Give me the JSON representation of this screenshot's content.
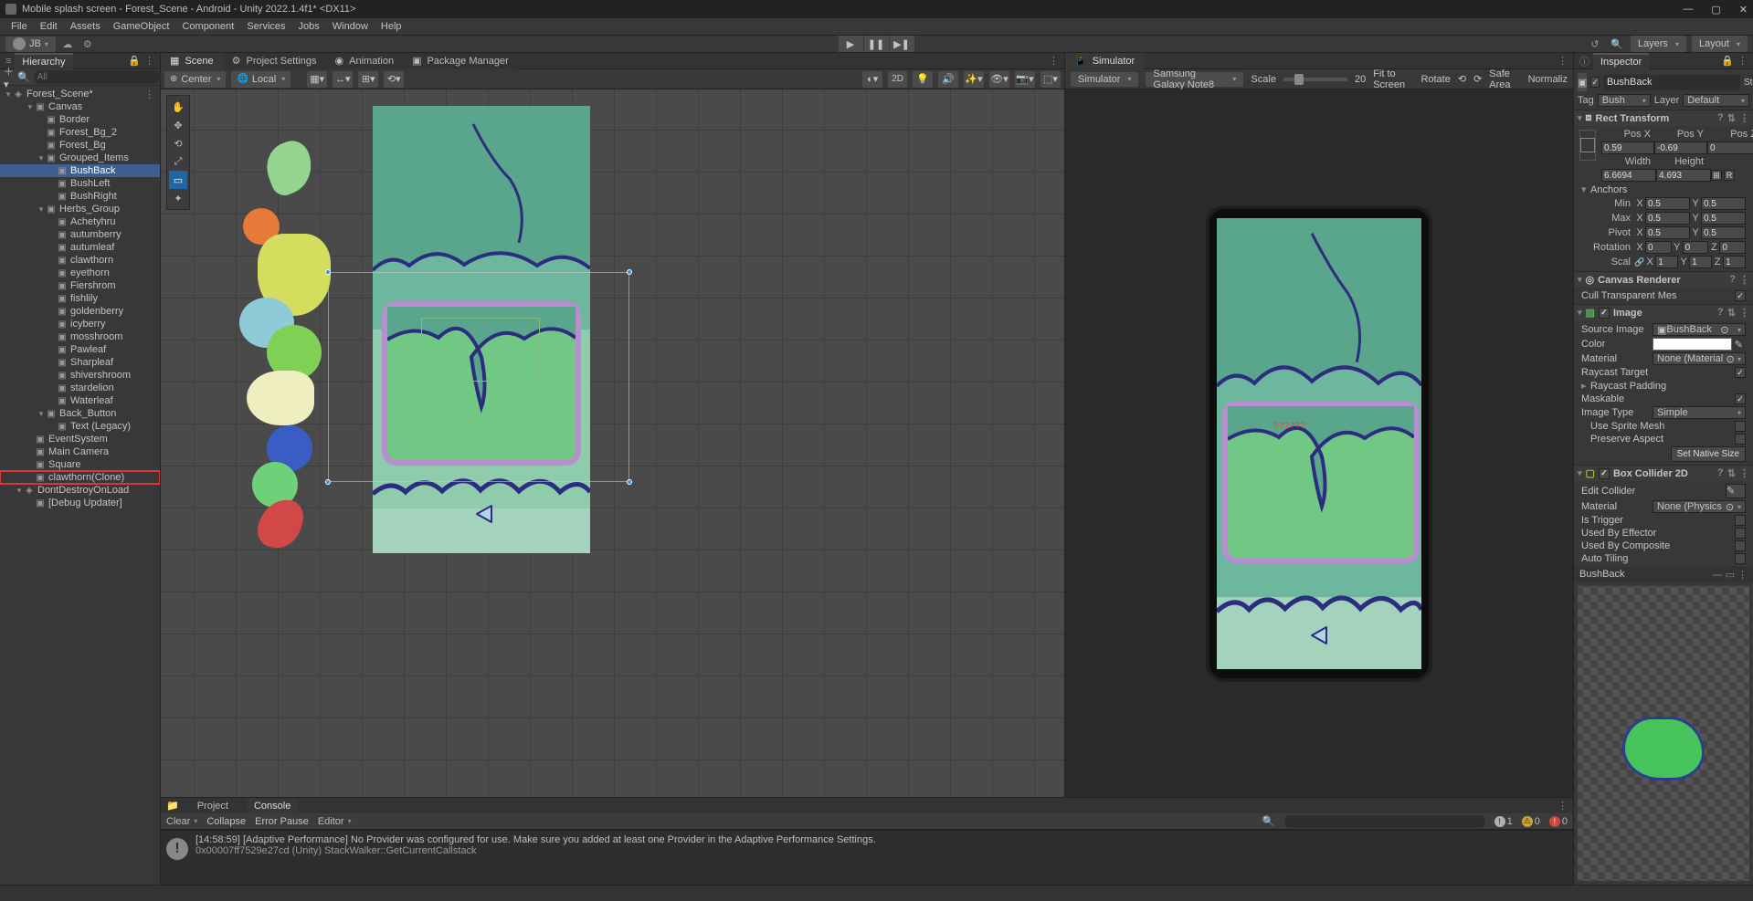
{
  "window": {
    "title": "Mobile splash screen - Forest_Scene - Android - Unity 2022.1.4f1* <DX11>"
  },
  "menu": [
    "File",
    "Edit",
    "Assets",
    "GameObject",
    "Component",
    "Services",
    "Jobs",
    "Window",
    "Help"
  ],
  "account": {
    "initials": "JB"
  },
  "layers_label": "Layers",
  "layout_label": "Layout",
  "hierarchy": {
    "title": "Hierarchy",
    "search_placeholder": "All",
    "scene": "Forest_Scene*",
    "tree": [
      {
        "label": "Canvas",
        "depth": 1,
        "folder": true
      },
      {
        "label": "Border",
        "depth": 2
      },
      {
        "label": "Forest_Bg_2",
        "depth": 2
      },
      {
        "label": "Forest_Bg",
        "depth": 2
      },
      {
        "label": "Grouped_Items",
        "depth": 2,
        "folder": true
      },
      {
        "label": "BushBack",
        "depth": 3,
        "selected": true
      },
      {
        "label": "BushLeft",
        "depth": 3
      },
      {
        "label": "BushRight",
        "depth": 3
      },
      {
        "label": "Herbs_Group",
        "depth": 2,
        "folder": true
      },
      {
        "label": "Achetyhru",
        "depth": 3
      },
      {
        "label": "autumberry",
        "depth": 3
      },
      {
        "label": "autumleaf",
        "depth": 3
      },
      {
        "label": "clawthorn",
        "depth": 3
      },
      {
        "label": "eyethorn",
        "depth": 3
      },
      {
        "label": "Fiershrom",
        "depth": 3
      },
      {
        "label": "fishlily",
        "depth": 3
      },
      {
        "label": "goldenberry",
        "depth": 3
      },
      {
        "label": "icyberry",
        "depth": 3
      },
      {
        "label": "mosshroom",
        "depth": 3
      },
      {
        "label": "Pawleaf",
        "depth": 3
      },
      {
        "label": "Sharpleaf",
        "depth": 3
      },
      {
        "label": "shivershroom",
        "depth": 3
      },
      {
        "label": "stardelion",
        "depth": 3
      },
      {
        "label": "Waterleaf",
        "depth": 3
      },
      {
        "label": "Back_Button",
        "depth": 2,
        "folder": true
      },
      {
        "label": "Text (Legacy)",
        "depth": 3
      },
      {
        "label": "EventSystem",
        "depth": 1
      },
      {
        "label": "Main Camera",
        "depth": 1
      },
      {
        "label": "Square",
        "depth": 1
      },
      {
        "label": "clawthorn(Clone)",
        "depth": 1,
        "boxed": true
      },
      {
        "label": "DontDestroyOnLoad",
        "depth": 0,
        "scene": true
      },
      {
        "label": "[Debug Updater]",
        "depth": 1
      }
    ]
  },
  "scene_tabs": [
    {
      "label": "Scene",
      "active": true,
      "icon": "scene"
    },
    {
      "label": "Project Settings",
      "icon": "gear"
    },
    {
      "label": "Animation",
      "icon": "anim"
    },
    {
      "label": "Package Manager",
      "icon": "pkg"
    }
  ],
  "scene_toolbar": {
    "pivot": "Center",
    "space": "Local",
    "two_d": "2D"
  },
  "simulator": {
    "title": "Simulator",
    "dropdown": "Simulator",
    "device": "Samsung Galaxy Note8",
    "scale_label": "Scale",
    "scale_value": "20",
    "fit": "Fit to Screen",
    "rotate": "Rotate",
    "safe": "Safe Area",
    "norm": "Normaliz"
  },
  "inspector": {
    "title": "Inspector",
    "go_name": "BushBack",
    "static": "Static",
    "tag_label": "Tag",
    "tag": "Bush",
    "layer_label": "Layer",
    "layer": "Default",
    "rect": {
      "title": "Rect Transform",
      "posx_l": "Pos X",
      "posy_l": "Pos Y",
      "posz_l": "Pos Z",
      "posx": "0.59",
      "posy": "-0.69",
      "posz": "0",
      "width_l": "Width",
      "height_l": "Height",
      "width": "6.6694",
      "height": "4.693",
      "anchors": "Anchors",
      "min_l": "Min",
      "min_x": "0.5",
      "min_y": "0.5",
      "max_l": "Max",
      "max_x": "0.5",
      "max_y": "0.5",
      "pivot_l": "Pivot",
      "piv_x": "0.5",
      "piv_y": "0.5",
      "rotation_l": "Rotation",
      "rot_x": "0",
      "rot_y": "0",
      "rot_z": "0",
      "scale_l": "Scal",
      "scl_x": "1",
      "scl_y": "1",
      "scl_z": "1"
    },
    "canvas_renderer": {
      "title": "Canvas Renderer",
      "cull": "Cull Transparent Mes"
    },
    "image": {
      "title": "Image",
      "src_l": "Source Image",
      "src": "BushBack",
      "color_l": "Color",
      "mat_l": "Material",
      "mat": "None (Material",
      "ray_l": "Raycast Target",
      "rayp_l": "Raycast Padding",
      "mask_l": "Maskable",
      "imgt_l": "Image Type",
      "imgt": "Simple",
      "spr_l": "Use Sprite Mesh",
      "presv_l": "Preserve Aspect",
      "setnat": "Set Native Size"
    },
    "box": {
      "title": "Box Collider 2D",
      "edit_l": "Edit Collider",
      "mat_l": "Material",
      "mat": "None (Physics",
      "trig_l": "Is Trigger",
      "eff_l": "Used By Effector",
      "comp_l": "Used By Composite",
      "auto_l": "Auto Tiling"
    },
    "preview_name": "BushBack"
  },
  "project_tabs": {
    "project": "Project",
    "console": "Console"
  },
  "console_toolbar": {
    "clear": "Clear",
    "collapse": "Collapse",
    "errp": "Error Pause",
    "editor": "Editor"
  },
  "console_counts": {
    "info": "1",
    "warn": "0",
    "err": "0"
  },
  "console_msg": {
    "ts": "[14:58:59] [Adaptive Performance] No Provider was configured for use. Make sure you added at least one Provider in the Adaptive Performance Settings.",
    "stack": "0x00007ff7529e27cd (Unity) StackWalker::GetCurrentCallstack"
  }
}
